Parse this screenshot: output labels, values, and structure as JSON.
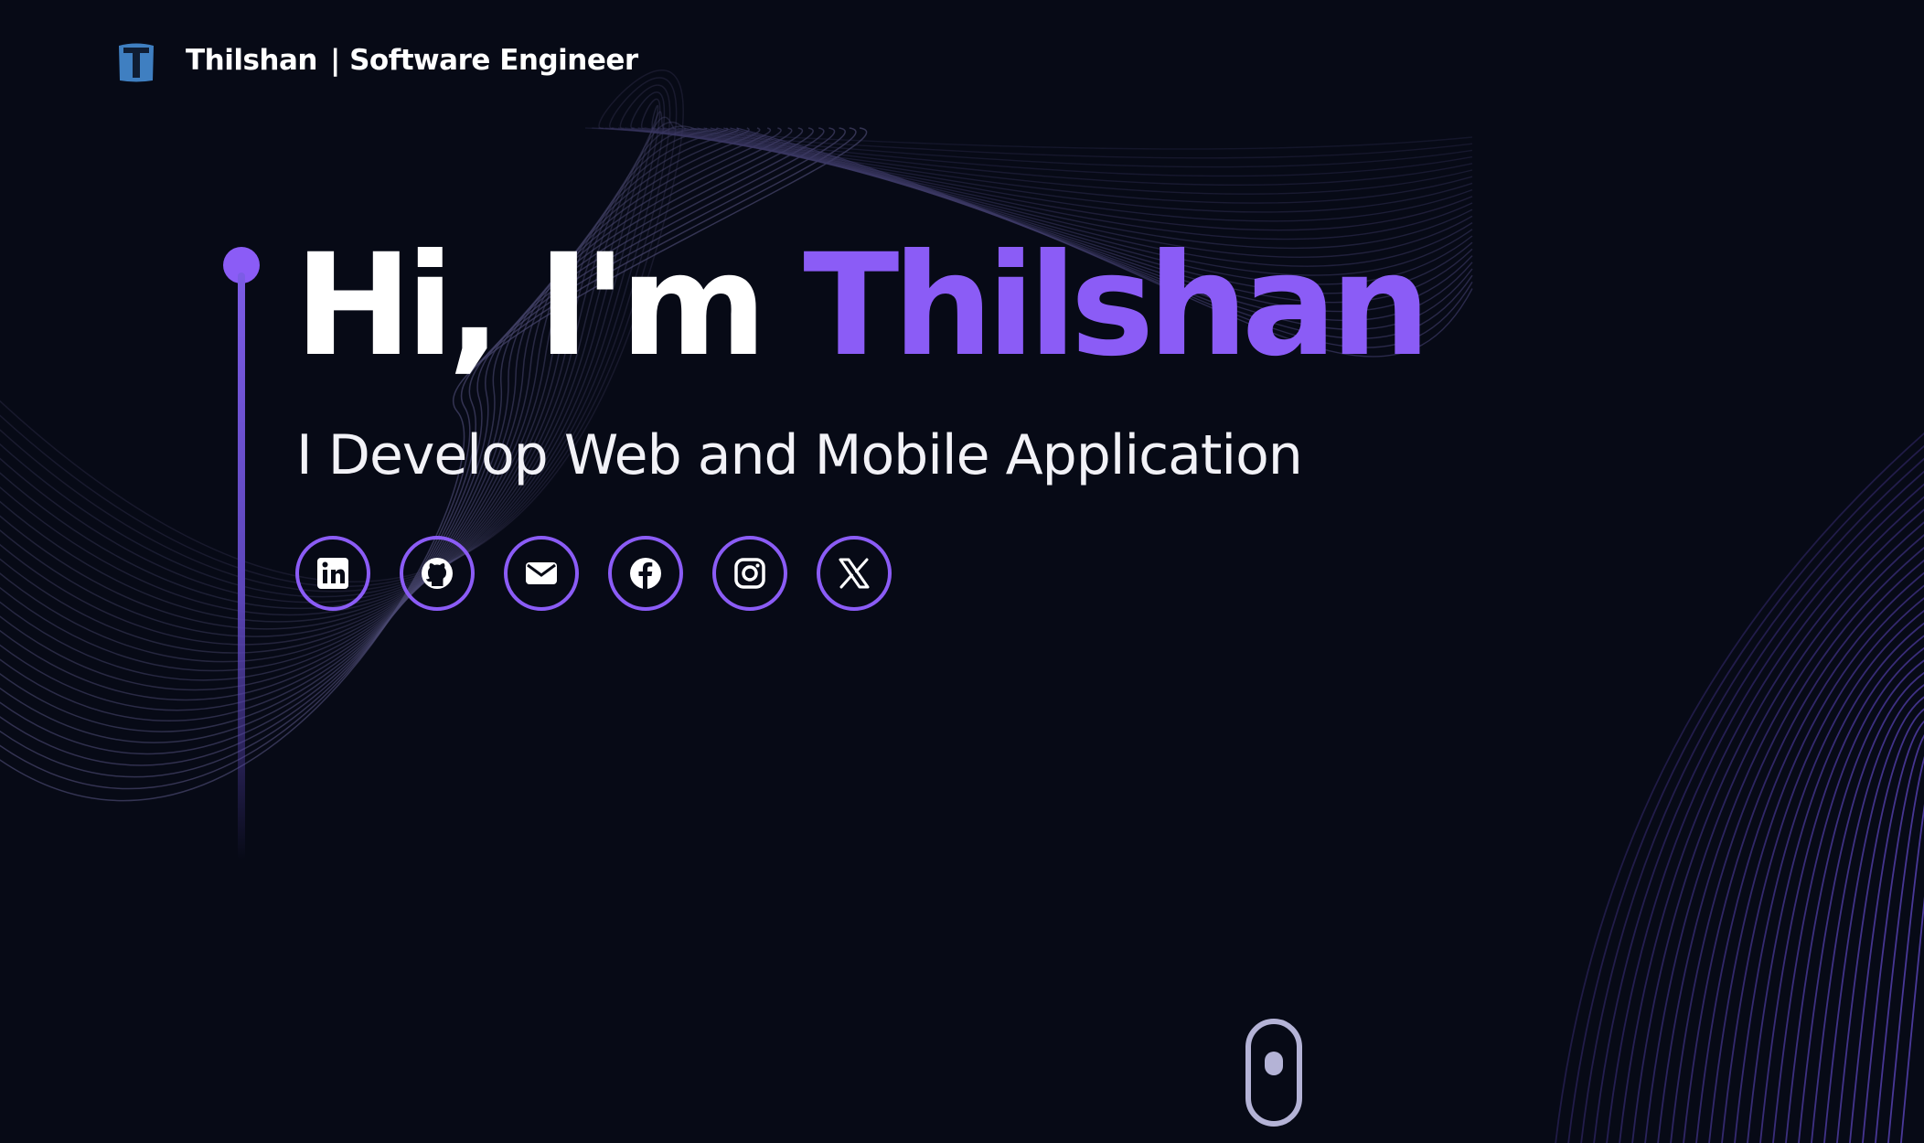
{
  "header": {
    "logo_letter": "T",
    "brand_name": "Thilshan",
    "brand_role": "| Software Engineer"
  },
  "hero": {
    "greeting": "Hi, I'm",
    "name": "Thilshan",
    "subtitle": "I Develop Web and Mobile Application"
  },
  "socials": [
    {
      "icon": "linkedin-icon"
    },
    {
      "icon": "github-icon"
    },
    {
      "icon": "email-icon"
    },
    {
      "icon": "facebook-icon"
    },
    {
      "icon": "instagram-icon"
    },
    {
      "icon": "x-icon"
    }
  ],
  "colors": {
    "background": "#070a16",
    "accent": "#8b5cf6",
    "text": "#ffffff",
    "scroll_indicator": "#b4b3d6",
    "logo": "#3f7fc1"
  }
}
